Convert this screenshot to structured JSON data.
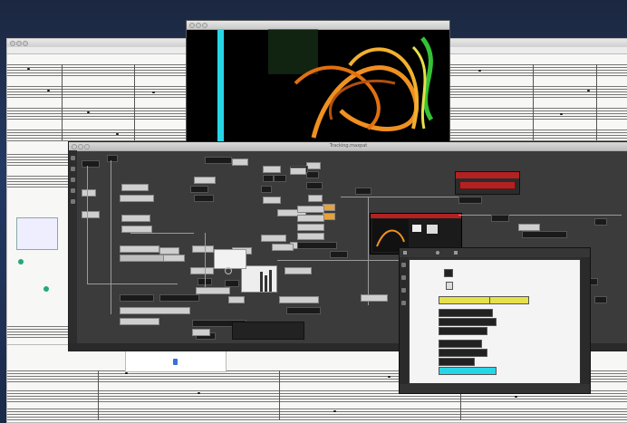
{
  "windows": {
    "score_left": {
      "title": ""
    },
    "score_bottom": {
      "title": ""
    },
    "video": {
      "title": ""
    },
    "patcher": {
      "title": "Tracking.maxpat"
    },
    "inner_patcher": {
      "title": ""
    }
  },
  "popup": {
    "header": "",
    "item": ""
  },
  "colors": {
    "desktop": "#1b2740",
    "patcher_bg": "#3b3b3b",
    "accent_red": "#b22222",
    "accent_cyan": "#27d6e6",
    "orange": "#f0a020",
    "yellow": "#e6e04a",
    "green": "#34c234"
  },
  "icons": [
    "close-icon",
    "minimize-icon",
    "zoom-icon",
    "lock-icon",
    "plus-icon",
    "gear-icon"
  ]
}
